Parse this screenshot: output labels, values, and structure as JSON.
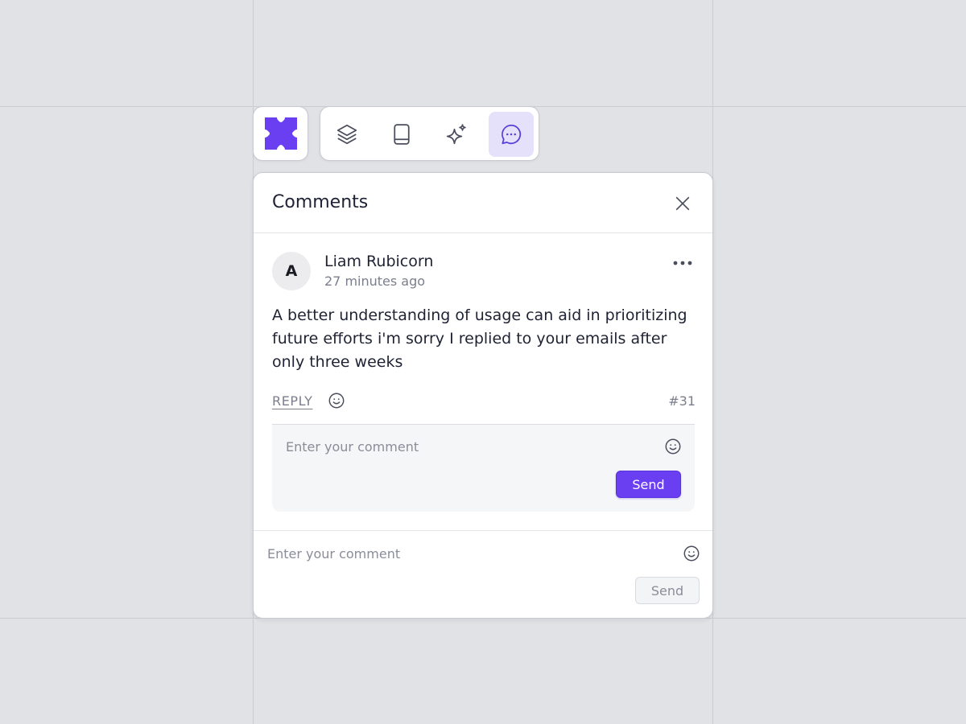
{
  "colors": {
    "accent": "#6a3ff1",
    "active_tab_bg": "#e6e1fb",
    "background": "#e1e2e6"
  },
  "app": {
    "logo_icon": "brand-logo-icon"
  },
  "toolbar": {
    "tools": [
      {
        "icon": "layers-icon",
        "active": false
      },
      {
        "icon": "book-icon",
        "active": false
      },
      {
        "icon": "sparkle-icon",
        "active": false
      },
      {
        "icon": "chat-bubble-icon",
        "active": true
      }
    ]
  },
  "panel": {
    "title": "Comments",
    "close_icon": "close-icon"
  },
  "comment": {
    "avatar_initial": "A",
    "author": "Liam Rubicorn",
    "timestamp": "27 minutes ago",
    "more_icon": "more-horizontal-icon",
    "body": "A better understanding of usage can aid in prioritizing future efforts i'm sorry I replied to your emails after only three weeks",
    "reply_label": "REPLY",
    "react_icon": "smiley-icon",
    "number": "#31"
  },
  "reply_box": {
    "placeholder": "Enter your comment",
    "emoji_icon": "smiley-icon",
    "send_label": "Send"
  },
  "new_comment": {
    "placeholder": "Enter your comment",
    "emoji_icon": "smiley-icon",
    "send_label": "Send",
    "send_enabled": false
  }
}
